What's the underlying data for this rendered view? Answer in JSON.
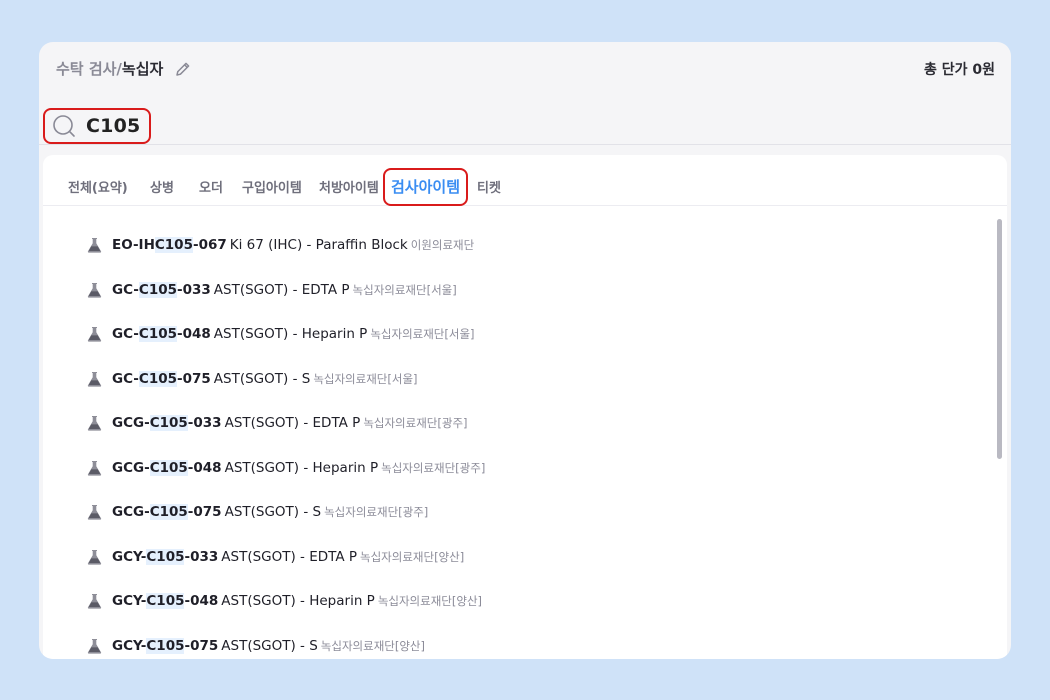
{
  "header": {
    "breadcrumb_parent": "수탁 검사/",
    "breadcrumb_current": "녹십자",
    "total_label": "총 단가 0원"
  },
  "search": {
    "query": "C105"
  },
  "tabs": [
    {
      "label": "전체(요약)"
    },
    {
      "label": "상병"
    },
    {
      "label": "오더"
    },
    {
      "label": "구입아이템"
    },
    {
      "label": "처방아이템"
    },
    {
      "label": "검사아이템",
      "active": true
    },
    {
      "label": "티켓"
    }
  ],
  "results": [
    {
      "code_pre": "EO-IH",
      "code_match": "C105",
      "code_post": "-067",
      "name": "Ki 67 (IHC) - Paraffin Block",
      "lab": "이원의료재단"
    },
    {
      "code_pre": "GC-",
      "code_match": "C105",
      "code_post": "-033",
      "name": "AST(SGOT) - EDTA P",
      "lab": "녹십자의료재단[서울]"
    },
    {
      "code_pre": "GC-",
      "code_match": "C105",
      "code_post": "-048",
      "name": "AST(SGOT) - Heparin P",
      "lab": "녹십자의료재단[서울]"
    },
    {
      "code_pre": "GC-",
      "code_match": "C105",
      "code_post": "-075",
      "name": "AST(SGOT) - S",
      "lab": "녹십자의료재단[서울]"
    },
    {
      "code_pre": "GCG-",
      "code_match": "C105",
      "code_post": "-033",
      "name": "AST(SGOT) - EDTA P",
      "lab": "녹십자의료재단[광주]"
    },
    {
      "code_pre": "GCG-",
      "code_match": "C105",
      "code_post": "-048",
      "name": "AST(SGOT) - Heparin P",
      "lab": "녹십자의료재단[광주]"
    },
    {
      "code_pre": "GCG-",
      "code_match": "C105",
      "code_post": "-075",
      "name": "AST(SGOT) - S",
      "lab": "녹십자의료재단[광주]"
    },
    {
      "code_pre": "GCY-",
      "code_match": "C105",
      "code_post": "-033",
      "name": "AST(SGOT) - EDTA P",
      "lab": "녹십자의료재단[양산]"
    },
    {
      "code_pre": "GCY-",
      "code_match": "C105",
      "code_post": "-048",
      "name": "AST(SGOT) - Heparin P",
      "lab": "녹십자의료재단[양산]"
    },
    {
      "code_pre": "GCY-",
      "code_match": "C105",
      "code_post": "-075",
      "name": "AST(SGOT) - S",
      "lab": "녹십자의료재단[양산]"
    }
  ],
  "colors": {
    "accent": "#3a8df2",
    "highlight_box": "#d91b1b",
    "match_bg": "#e5f0fd"
  },
  "icons": {
    "edit": "pencil-icon",
    "search": "search-icon",
    "result": "flask-icon"
  }
}
